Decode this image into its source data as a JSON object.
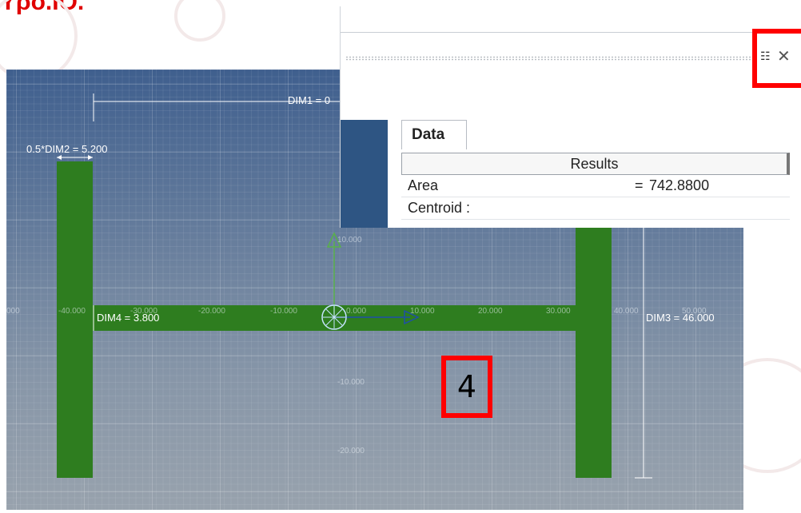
{
  "slide_title": "Υρό.ΙΟ.",
  "canvas": {
    "dims": {
      "dim1": "DIM1 = 0",
      "dim2": "0.5*DIM2 = 5.200",
      "dim3": "DIM3 = 46.000",
      "dim4": "DIM4 = 3.800"
    },
    "x_ticks": [
      "000",
      "-40.000",
      "-30.000",
      "-20.000",
      "-10.000",
      "0.000",
      "10.000",
      "20.000",
      "30.000",
      "40.000",
      "50.000"
    ],
    "y_ticks": [
      "10.000",
      "-10.000",
      "-20.000"
    ],
    "step_marker": "4"
  },
  "results_panel": {
    "tab": "Data",
    "header": "Results",
    "rows": [
      {
        "key": "Area",
        "eq": "=",
        "value": "742.8800"
      },
      {
        "key": "Centroid :",
        "eq": "",
        "value": ""
      }
    ],
    "grid_icon": "grid-icon",
    "close_icon": "close-icon"
  },
  "colors": {
    "beam": "#2e7d1f",
    "highlight": "#ff0000",
    "title": "#e00000"
  }
}
